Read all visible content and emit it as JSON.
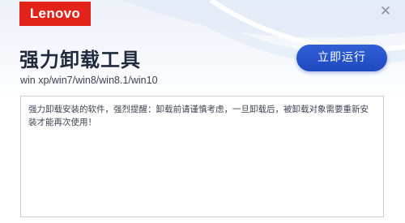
{
  "brand": {
    "logo_text": "Lenovo",
    "logo_color": "#e2231a"
  },
  "window": {
    "close_icon": "close-icon"
  },
  "header": {
    "title": "强力卸载工具",
    "subtitle": "win xp/win7/win8/win8.1/win10"
  },
  "actions": {
    "run_label": "立即运行",
    "accent_color": "#2651c9"
  },
  "content": {
    "message": "强力卸载安装的软件，强烈提醒：卸载前请谨慎考虑，一旦卸载后，被卸载对象需要重新安装才能再次使用！"
  }
}
